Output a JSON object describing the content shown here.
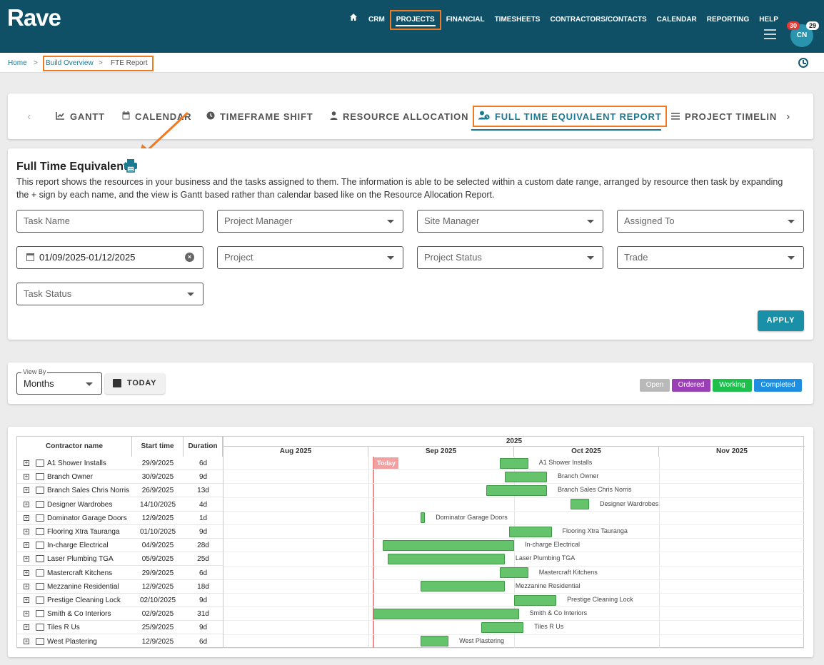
{
  "header": {
    "logo": "Rave",
    "nav": [
      "CRM",
      "PROJECTS",
      "FINANCIAL",
      "TIMESHEETS",
      "CONTRACTORS/CONTACTS",
      "CALENDAR",
      "REPORTING",
      "HELP"
    ],
    "active_nav": "PROJECTS",
    "notifications_red": "30",
    "notifications_white": "29",
    "avatar_initials": "CN"
  },
  "breadcrumb": {
    "home": "Home",
    "sep": ">",
    "build_overview": "Build Overview",
    "current": "FTE Report"
  },
  "tabs": [
    {
      "label": "GANTT",
      "icon": "chart-line-icon"
    },
    {
      "label": "CALENDAR",
      "icon": "calendar-icon"
    },
    {
      "label": "TIMEFRAME SHIFT",
      "icon": "clock-icon"
    },
    {
      "label": "RESOURCE ALLOCATION",
      "icon": "person-icon"
    },
    {
      "label": "FULL TIME EQUIVALENT REPORT",
      "icon": "person-clock-icon"
    },
    {
      "label": "PROJECT TIMELIN",
      "icon": "list-icon"
    }
  ],
  "report": {
    "title": "Full Time Equivalent",
    "description": "This report shows the resources in your business and the tasks assigned to them. The information is able to be selected within a custom date range, arranged by resource then task by expanding the + sign by each name, and the view is Gantt based rather than calendar based like on the Resource Allocation Report."
  },
  "filters": {
    "task_name": "Task Name",
    "project_manager": "Project Manager",
    "site_manager": "Site Manager",
    "assigned_to": "Assigned To",
    "date_range": "01/09/2025-01/12/2025",
    "project": "Project",
    "project_status": "Project Status",
    "trade": "Trade",
    "task_status": "Task Status",
    "apply_label": "APPLY"
  },
  "view": {
    "view_by_label": "View By",
    "view_by_value": "Months",
    "today_label": "TODAY"
  },
  "legend": [
    {
      "label": "Open",
      "color": "#b9b9b9"
    },
    {
      "label": "Ordered",
      "color": "#9b3fb5"
    },
    {
      "label": "Working",
      "color": "#1fbf4e"
    },
    {
      "label": "Completed",
      "color": "#1e8fe0"
    }
  ],
  "gantt": {
    "columns": [
      "Contractor name",
      "Start time",
      "Duration"
    ],
    "year": "2025",
    "months": [
      "Aug 2025",
      "Sep 2025",
      "Oct 2025",
      "Nov 2025"
    ],
    "today_label": "Today",
    "today_date": "2025-09-01",
    "rows": [
      {
        "name": "A1 Shower Installs",
        "start": "29/9/2025",
        "duration": "6d",
        "days": 6
      },
      {
        "name": "Branch Owner",
        "start": "30/9/2025",
        "duration": "9d",
        "days": 9
      },
      {
        "name": "Branch Sales Chris Norris",
        "start": "26/9/2025",
        "duration": "13d",
        "days": 13
      },
      {
        "name": "Designer Wardrobes",
        "start": "14/10/2025",
        "duration": "4d",
        "days": 4
      },
      {
        "name": "Dominator Garage Doors",
        "start": "12/9/2025",
        "duration": "1d",
        "days": 1
      },
      {
        "name": "Flooring Xtra Tauranga",
        "start": "01/10/2025",
        "duration": "9d",
        "days": 9
      },
      {
        "name": "In-charge Electrical",
        "start": "04/9/2025",
        "duration": "28d",
        "days": 28
      },
      {
        "name": "Laser Plumbing TGA",
        "start": "05/9/2025",
        "duration": "25d",
        "days": 25
      },
      {
        "name": "Mastercraft Kitchens",
        "start": "29/9/2025",
        "duration": "6d",
        "days": 6
      },
      {
        "name": "Mezzanine Residential",
        "start": "12/9/2025",
        "duration": "18d",
        "days": 18
      },
      {
        "name": "Prestige Cleaning Lock",
        "start": "02/10/2025",
        "duration": "9d",
        "days": 9
      },
      {
        "name": "Smith & Co Interiors",
        "start": "02/9/2025",
        "duration": "31d",
        "days": 31
      },
      {
        "name": "Tiles R Us",
        "start": "25/9/2025",
        "duration": "9d",
        "days": 9
      },
      {
        "name": "West Plastering",
        "start": "12/9/2025",
        "duration": "6d",
        "days": 6
      }
    ]
  }
}
